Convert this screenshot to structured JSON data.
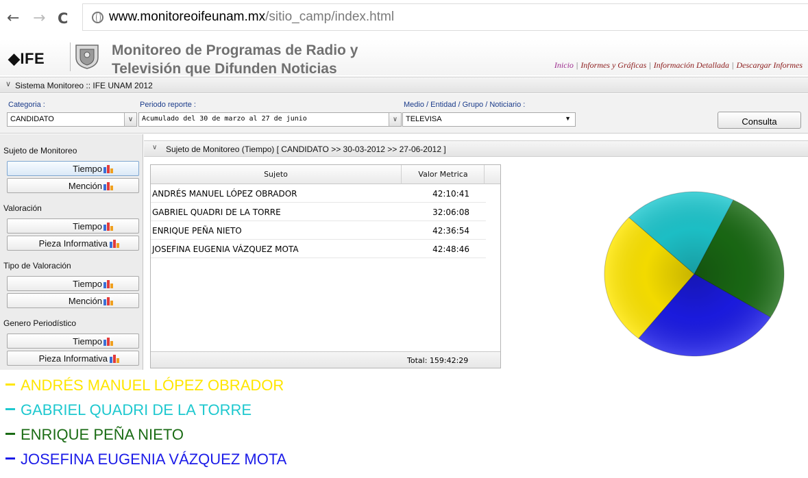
{
  "browser": {
    "url_host": "www.monitoreoifeunam.mx",
    "url_path": "/sitio_camp/index.html"
  },
  "header": {
    "logo_text": "◆IFE",
    "title_line1": "Monitoreo de Programas de Radio y",
    "title_line2": "Televisión que Difunden Noticias",
    "nav": [
      "Inicio",
      "Informes y Gráficas",
      "Información Detallada",
      "Descargar Informes"
    ]
  },
  "system_bar": {
    "label": "Sistema Monitoreo :: IFE UNAM 2012"
  },
  "filters": {
    "categoria_label": "Categoria :",
    "categoria_value": "CANDIDATO",
    "periodo_label": "Periodo reporte :",
    "periodo_value": "Acumulado del 30 de marzo al 27 de junio",
    "medio_label": "Medio / Entidad / Grupo / Noticiario :",
    "medio_value": "TELEVISA",
    "consulta_label": "Consulta"
  },
  "left_panel": {
    "sections": [
      {
        "label": "Sujeto de Monitoreo",
        "items": [
          "Tiempo",
          "Mención"
        ]
      },
      {
        "label": "Valoración",
        "items": [
          "Tiempo",
          "Pieza Informativa"
        ]
      },
      {
        "label": "Tipo de Valoración",
        "items": [
          "Tiempo",
          "Mención"
        ]
      },
      {
        "label": "Genero Periodístico",
        "items": [
          "Tiempo",
          "Pieza Informativa"
        ]
      }
    ]
  },
  "content": {
    "title": "Sujeto de Monitoreo (Tiempo) [ CANDIDATO >> 30-03-2012 >> 27-06-2012 ]",
    "table": {
      "headers": [
        "Sujeto",
        "Valor Metrica"
      ],
      "rows": [
        [
          "ANDRÉS MANUEL LÓPEZ OBRADOR",
          "42:10:41"
        ],
        [
          "GABRIEL QUADRI DE LA TORRE",
          "32:06:08"
        ],
        [
          "ENRIQUE PEÑA NIETO",
          "42:36:54"
        ],
        [
          "JOSEFINA EUGENIA VÁZQUEZ MOTA",
          "42:48:46"
        ]
      ],
      "total": "Total: 159:42:29"
    }
  },
  "legend": [
    {
      "label": "ANDRÉS MANUEL LÓPEZ OBRADOR",
      "color": "#ffe600"
    },
    {
      "label": "GABRIEL QUADRI DE LA TORRE",
      "color": "#1ec8cf"
    },
    {
      "label": "ENRIQUE PEÑA NIETO",
      "color": "#1a6b14"
    },
    {
      "label": "JOSEFINA EUGENIA VÁZQUEZ MOTA",
      "color": "#1c1ce8"
    }
  ],
  "chart_data": {
    "type": "pie",
    "labels": [
      "ANDRÉS MANUEL LÓPEZ OBRADOR",
      "GABRIEL QUADRI DE LA TORRE",
      "ENRIQUE PEÑA NIETO",
      "JOSEFINA EUGENIA VÁZQUEZ MOTA"
    ],
    "values": [
      42.178,
      32.102,
      42.615,
      42.813
    ],
    "colors": [
      "#ffe600",
      "#1ec8cf",
      "#1a6b14",
      "#1c1ce8"
    ]
  }
}
